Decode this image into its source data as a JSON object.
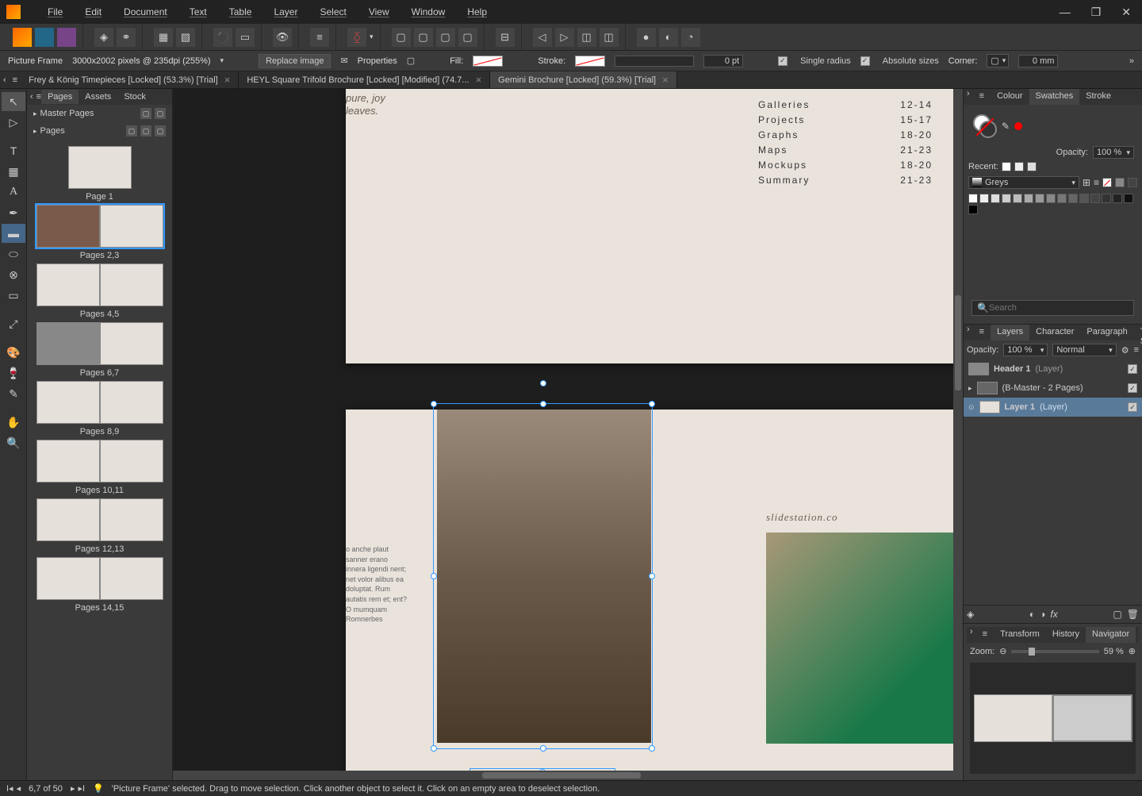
{
  "menu": {
    "items": [
      "File",
      "Edit",
      "Document",
      "Text",
      "Table",
      "Layer",
      "Select",
      "View",
      "Window",
      "Help"
    ]
  },
  "context": {
    "tool": "Picture Frame",
    "dims": "3000x2002 pixels @ 235dpi (255%)",
    "replace": "Replace image",
    "properties": "Properties",
    "fill": "Fill:",
    "stroke": "Stroke:",
    "stroke_val": "0 pt",
    "single_radius": "Single radius",
    "absolute_sizes": "Absolute sizes",
    "corner": "Corner:",
    "corner_val": "0 mm"
  },
  "doc_tabs": [
    {
      "label": "Frey & König Timepieces [Locked] (53.3%) [Trial]"
    },
    {
      "label": "HEYL Square Trifold Brochure [Locked] [Modified] (74.7..."
    },
    {
      "label": "Gemini Brochure [Locked] (59.3%) [Trial]"
    }
  ],
  "pages_panel": {
    "tabs": [
      "Pages",
      "Assets",
      "Stock"
    ],
    "master": "Master Pages",
    "pages": "Pages",
    "thumbs": [
      {
        "label": "Page 1"
      },
      {
        "label": "Pages 2,3",
        "selected": true
      },
      {
        "label": "Pages 4,5"
      },
      {
        "label": "Pages 6,7"
      },
      {
        "label": "Pages 8,9"
      },
      {
        "label": "Pages 10,11"
      },
      {
        "label": "Pages 12,13"
      },
      {
        "label": "Pages 14,15"
      }
    ]
  },
  "canvas": {
    "cursive1": "pure, joy",
    "cursive2": "leaves.",
    "toc": [
      {
        "t": "Galleries",
        "p": "12-14"
      },
      {
        "t": "Projects",
        "p": "15-17"
      },
      {
        "t": "Graphs",
        "p": "18-20"
      },
      {
        "t": "Maps",
        "p": "21-23"
      },
      {
        "t": "Mockups",
        "p": "18-20"
      },
      {
        "t": "Summary",
        "p": "21-23"
      }
    ],
    "website": "slidestation.co",
    "lorem": "o anche plaut sanner erano innera ligendi nent; net volor alibus ea doluptat. Rum autatis rem et; ent? O mumquam Romnerbes"
  },
  "right": {
    "top_tabs": [
      "Colour",
      "Swatches",
      "Stroke"
    ],
    "opacity_label": "Opacity:",
    "opacity_val": "100 %",
    "recent": "Recent:",
    "palette": "Greys",
    "search_placeholder": "Search",
    "mid_tabs": [
      "Layers",
      "Character",
      "Paragraph",
      "Text Styles"
    ],
    "layer_opacity_label": "Opacity:",
    "layer_opacity_val": "100 %",
    "blend": "Normal",
    "layers": [
      {
        "name": "Header 1",
        "type": "(Layer)"
      },
      {
        "name": "(B-Master - 2 Pages)",
        "type": ""
      },
      {
        "name": "Layer 1",
        "type": "(Layer)",
        "selected": true
      }
    ],
    "bot_tabs": [
      "Transform",
      "History",
      "Navigator"
    ],
    "zoom_label": "Zoom:",
    "zoom_val": "59 %"
  },
  "status": {
    "page": "6,7 of 50",
    "hint": "'Picture Frame' selected. Drag to move selection. Click another object to select it. Click on an empty area to deselect selection."
  }
}
